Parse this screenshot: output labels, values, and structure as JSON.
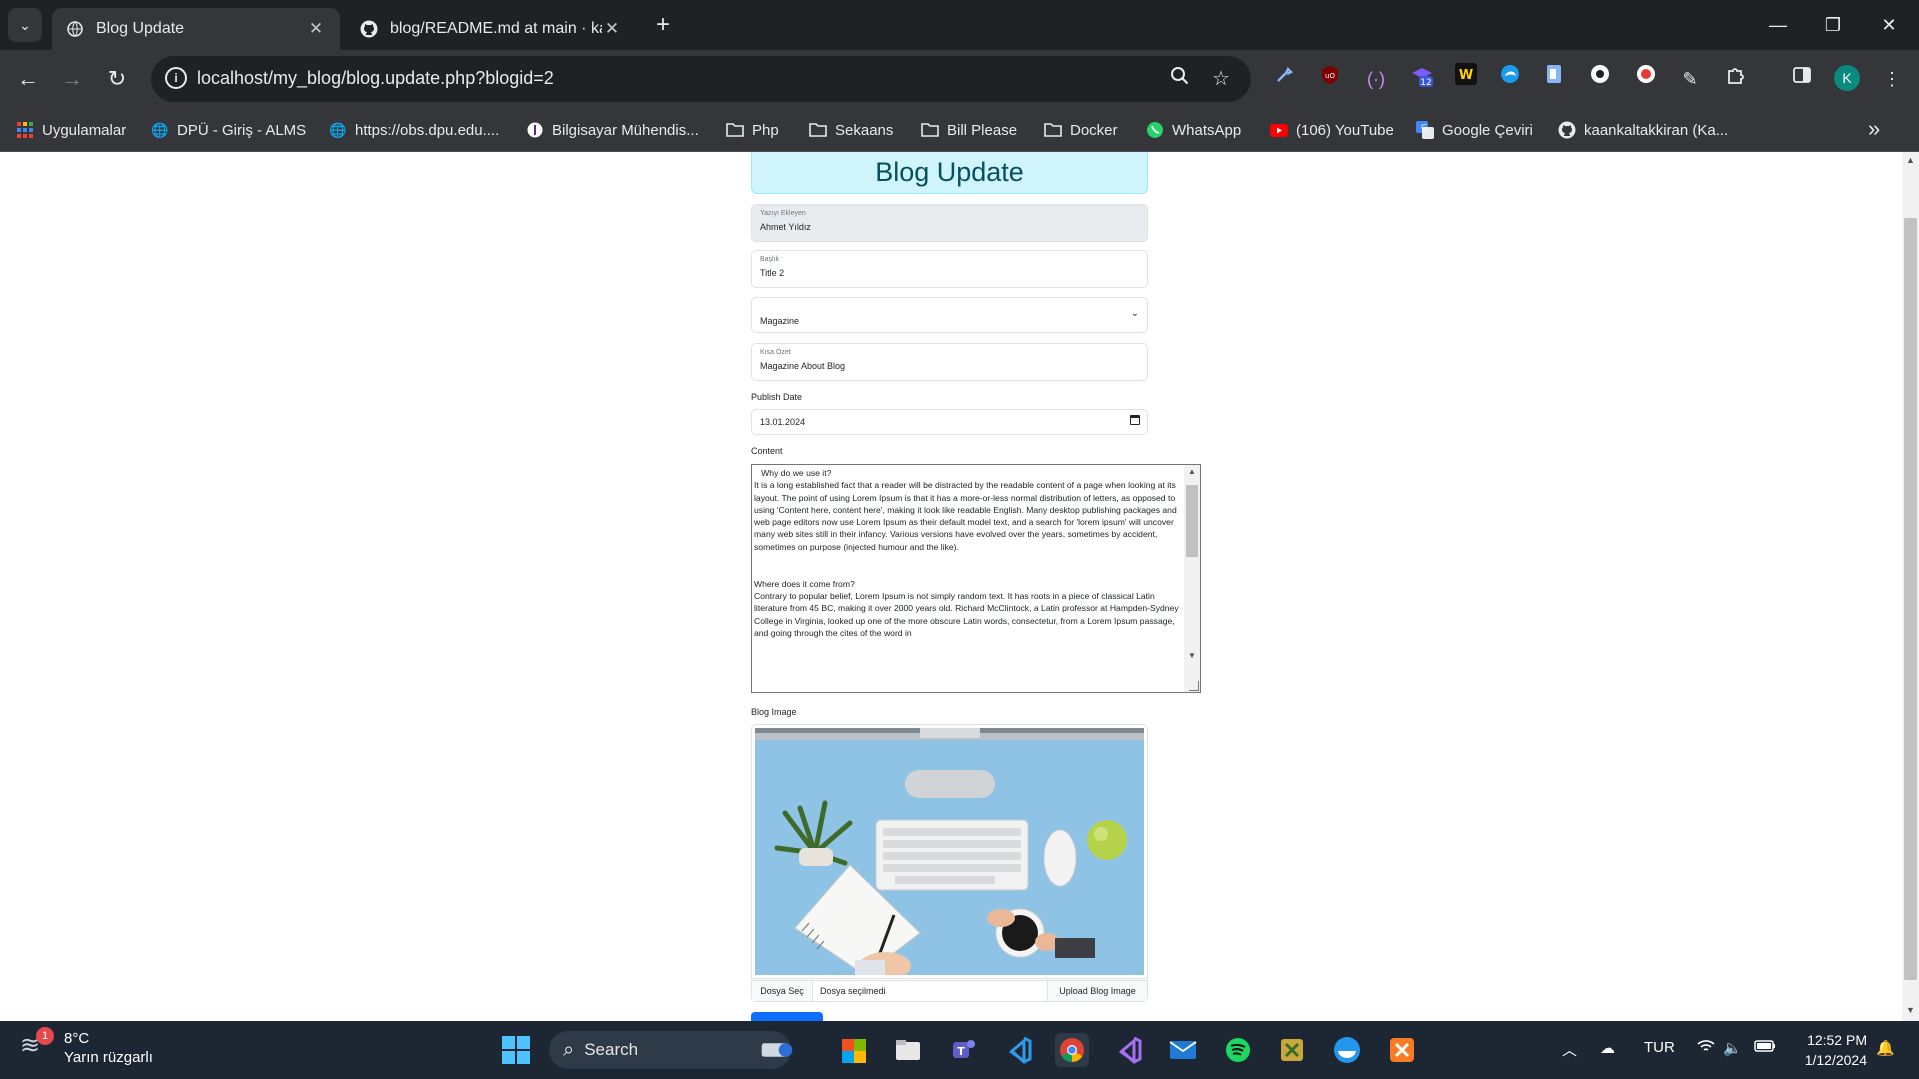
{
  "browser": {
    "tabs": [
      {
        "title": "Blog Update",
        "active": true
      },
      {
        "title": "blog/README.md at main · kaa",
        "active": false
      }
    ],
    "url": "localhost/my_blog/blog.update.php?blogid=2",
    "profile_initial": "K",
    "extension_badge": "12",
    "bookmarks": [
      {
        "label": "Uygulamalar",
        "icon": "apps-grid-icon"
      },
      {
        "label": "DPÜ - Giriş - ALMS",
        "icon": "globe-icon"
      },
      {
        "label": "https://obs.dpu.edu....",
        "icon": "globe-icon"
      },
      {
        "label": "Bilgisayar Mühendis...",
        "icon": "info-icon"
      },
      {
        "label": "Php",
        "icon": "folder-icon"
      },
      {
        "label": "Sekaans",
        "icon": "folder-icon"
      },
      {
        "label": "Bill Please",
        "icon": "folder-icon"
      },
      {
        "label": "Docker",
        "icon": "folder-icon"
      },
      {
        "label": "WhatsApp",
        "icon": "whatsapp-icon"
      },
      {
        "label": "(106) YouTube",
        "icon": "youtube-icon"
      },
      {
        "label": "Google Çeviri",
        "icon": "translate-icon"
      },
      {
        "label": "kaankaltakkiran (Ka...",
        "icon": "github-icon"
      }
    ]
  },
  "page": {
    "header": "Blog Update",
    "author": {
      "label": "Yazıyı Ekleyen",
      "value": "Ahmet Yıldız"
    },
    "title_field": {
      "label": "Başlık",
      "value": "Title 2"
    },
    "category": {
      "value": "Magazine"
    },
    "summary": {
      "label": "Kısa Özet",
      "value": "Magazine About Blog"
    },
    "publish_date": {
      "label": "Publish Date",
      "value": "13.01.2024"
    },
    "content": {
      "label": "Content",
      "value": "   Why do we use it?\nIt is a long established fact that a reader will be distracted by the readable content of a page when looking at its layout. The point of using Lorem Ipsum is that it has a more-or-less normal distribution of letters, as opposed to using 'Content here, content here', making it look like readable English. Many desktop publishing packages and web page editors now use Lorem Ipsum as their default model text, and a search for 'lorem ipsum' will uncover many web sites still in their infancy. Various versions have evolved over the years, sometimes by accident, sometimes on purpose (injected humour and the like).\n\n\nWhere does it come from?\nContrary to popular belief, Lorem Ipsum is not simply random text. It has roots in a piece of classical Latin literature from 45 BC, making it over 2000 years old. Richard McClintock, a Latin professor at Hampden-Sydney College in Virginia, looked up one of the more obscure Latin words, consectetur, from a Lorem Ipsum passage, and going through the cites of the word in"
    },
    "image": {
      "label": "Blog Image"
    },
    "file": {
      "choose": "Dosya Seç",
      "chosen": "Dosya seçilmedi",
      "upload": "Upload Blog Image"
    }
  },
  "taskbar": {
    "weather": {
      "temp": "8°C",
      "desc": "Yarın rüzgarlı",
      "badge": "1"
    },
    "search": "Search",
    "language": "TUR",
    "time": "12:52 PM",
    "date": "1/12/2024"
  },
  "colors": {
    "chrome_dark": "#202124",
    "chrome_toolbar": "#35363a",
    "header_bg": "#cff4fc",
    "header_text": "#055160",
    "taskbar_bg": "#1c2733",
    "accent_blue": "#0d6efd"
  }
}
